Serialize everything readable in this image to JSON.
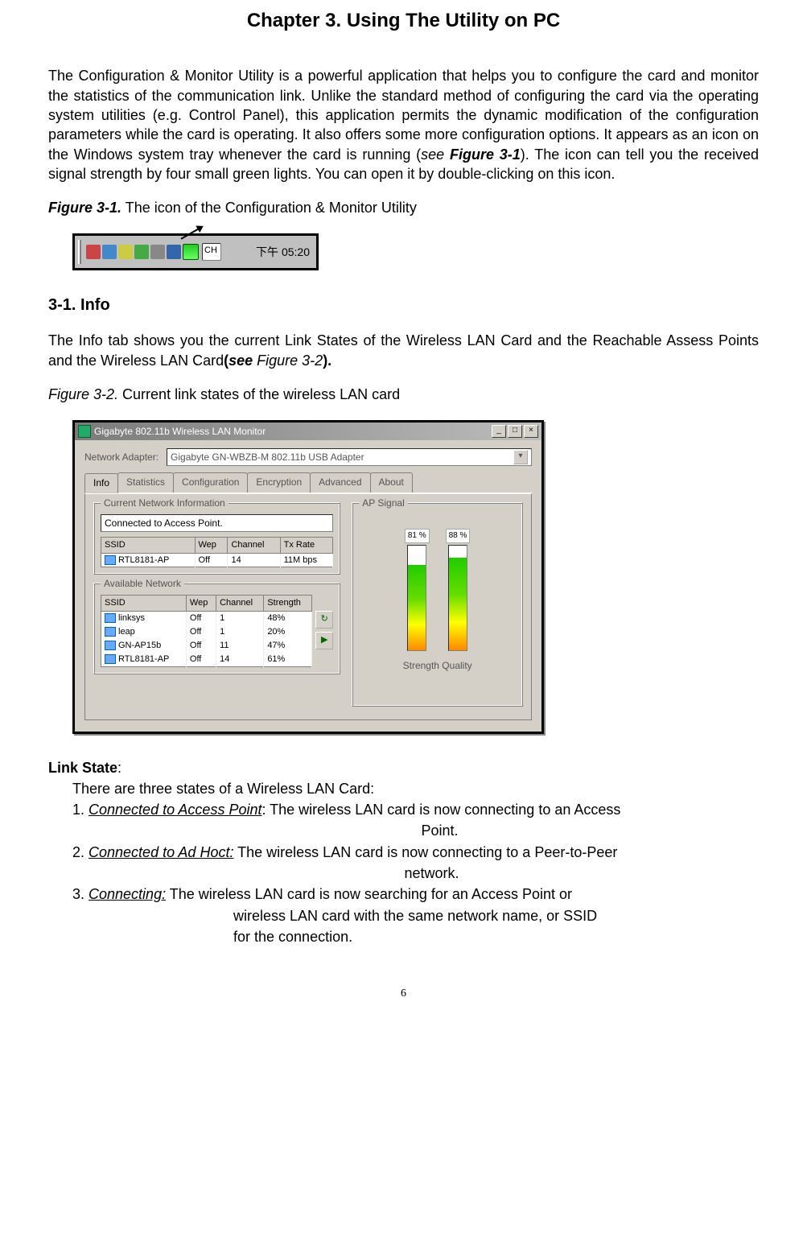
{
  "chapter_title": "Chapter 3. Using The Utility on PC",
  "intro_para_part1": "The Configuration & Monitor Utility is a powerful application that helps you to configure the card and monitor the statistics of the communication link. Unlike the standard method of configuring the card via the operating system utilities (e.g. Control Panel), this application permits the dynamic modification of the configuration parameters while the card is operating. It also offers some more configuration options. It appears as an icon on the Windows system tray whenever the card is running (",
  "intro_see_word": "see ",
  "intro_fig_ref": "Figure 3-1",
  "intro_para_part2": "). The icon can tell you the received signal strength by four small green lights. You can open it by double-clicking on this icon.",
  "fig31_label": "Figure 3-1.",
  "fig31_caption": "    The icon of the Configuration & Monitor Utility",
  "tray": {
    "ime": "CH",
    "time": "下午 05:20"
  },
  "section_31": "3-1.    Info",
  "info_para_part1": "The Info tab shows you the current Link States of the Wireless LAN Card and the Reachable Assess Points and the Wireless LAN Card",
  "info_open_paren": "(",
  "info_see_word": "see",
  "info_fig_ref": " Figure 3-2",
  "info_close": ").",
  "fig32_label": "Figure 3-2.",
  "fig32_caption": "    Current link states of the wireless LAN card",
  "monitor": {
    "title": "Gigabyte 802.11b Wireless LAN Monitor",
    "adapter_label": "Network Adapter:",
    "adapter_value": "Gigabyte GN-WBZB-M 802.11b USB Adapter",
    "tabs": [
      "Info",
      "Statistics",
      "Configuration",
      "Encryption",
      "Advanced",
      "About"
    ],
    "group_current": "Current Network Information",
    "connected_text": "Connected to Access Point.",
    "cols_current": [
      "SSID",
      "Wep",
      "Channel",
      "Tx Rate"
    ],
    "current_row": {
      "ssid": "RTL8181-AP",
      "wep": "Off",
      "channel": "14",
      "txrate": "11M bps"
    },
    "group_avail": "Available Network",
    "cols_avail": [
      "SSID",
      "Wep",
      "Channel",
      "Strength"
    ],
    "avail_rows": [
      {
        "ssid": "linksys",
        "wep": "Off",
        "channel": "1",
        "strength": "48%"
      },
      {
        "ssid": "leap",
        "wep": "Off",
        "channel": "1",
        "strength": "20%"
      },
      {
        "ssid": "GN-AP15b",
        "wep": "Off",
        "channel": "11",
        "strength": "47%"
      },
      {
        "ssid": "RTL8181-AP",
        "wep": "Off",
        "channel": "14",
        "strength": "61%"
      }
    ],
    "group_signal": "AP Signal",
    "pct1": "81 %",
    "pct2": "88 %",
    "sig_label": "Strength Quality"
  },
  "linkstate_heading": "Link State",
  "linkstate_colon": ":",
  "linkstate_intro": "There are three states of a Wireless LAN Card:",
  "ls1_num": "1. ",
  "ls1_u": "Connected to Access Point",
  "ls1_rest": ": The wireless LAN card is now connecting to an Access",
  "ls1_line2": "Point.",
  "ls2_num": "2. ",
  "ls2_u": "Connected to Ad Hoct:",
  "ls2_rest": " The wireless LAN card is now connecting to a Peer-to-Peer",
  "ls2_line2": "network.",
  "ls3_num": "3. ",
  "ls3_u": "Connecting:",
  "ls3_rest": " The wireless LAN card is now searching for an Access Point or",
  "ls3_line2": "wireless LAN card with the same network name, or SSID",
  "ls3_line3": "for the connection.",
  "page_number": "6"
}
